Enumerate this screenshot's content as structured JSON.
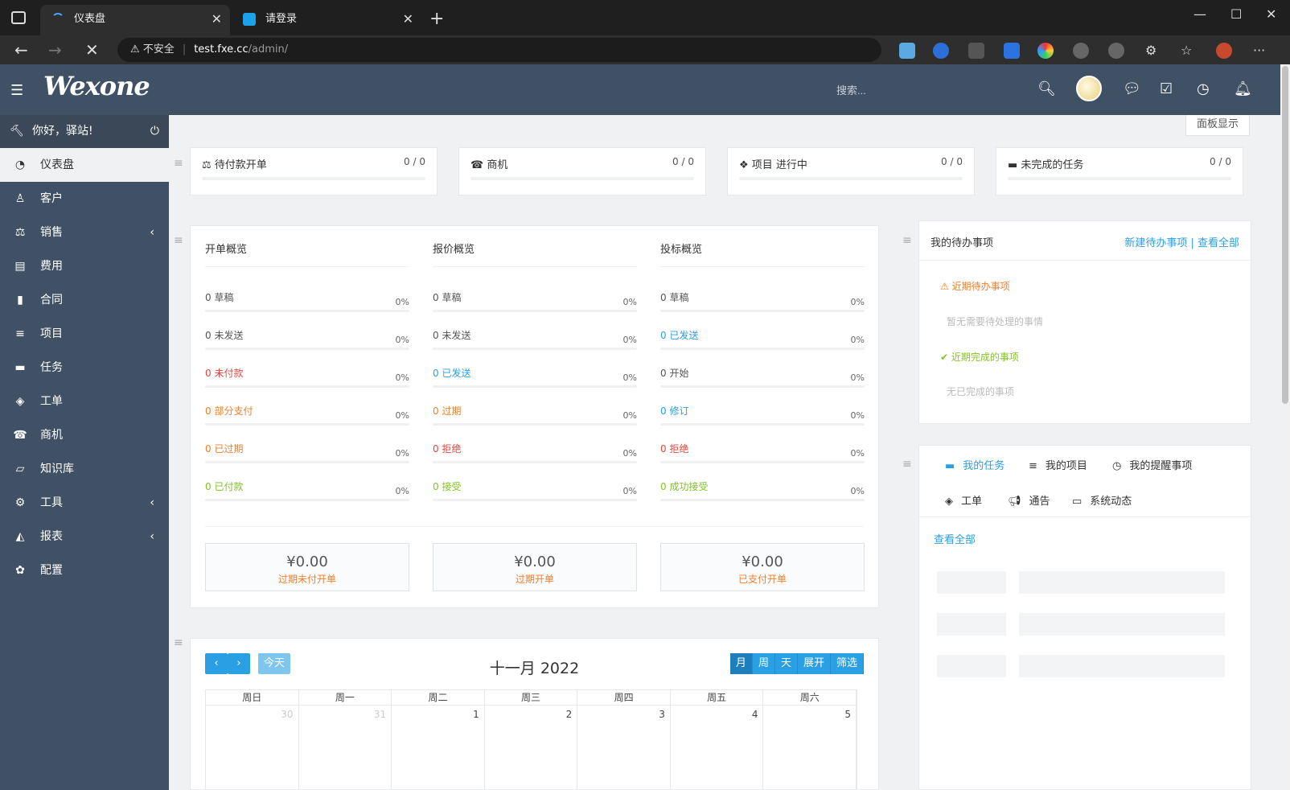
{
  "browser": {
    "tabs": [
      {
        "title": "仪表盘",
        "active": true
      },
      {
        "title": "请登录",
        "active": false
      }
    ],
    "security_label": "不安全",
    "url_domain": "test.fxe.cc",
    "url_path": "/admin/"
  },
  "header": {
    "logo": "Wexone",
    "search_placeholder": "搜索..."
  },
  "sidebar": {
    "greeting": "你好，驿站!",
    "items": [
      {
        "label": "仪表盘",
        "icon": "dashboard-icon",
        "active": true
      },
      {
        "label": "客户",
        "icon": "user-icon"
      },
      {
        "label": "销售",
        "icon": "balance-scale-icon",
        "has_submenu": true
      },
      {
        "label": "费用",
        "icon": "file-icon"
      },
      {
        "label": "合同",
        "icon": "contract-icon"
      },
      {
        "label": "项目",
        "icon": "bars-icon"
      },
      {
        "label": "任务",
        "icon": "tasks-icon"
      },
      {
        "label": "工单",
        "icon": "ticket-icon"
      },
      {
        "label": "商机",
        "icon": "tty-icon"
      },
      {
        "label": "知识库",
        "icon": "folder-open-icon"
      },
      {
        "label": "工具",
        "icon": "cogs-icon",
        "has_submenu": true
      },
      {
        "label": "报表",
        "icon": "area-chart-icon",
        "has_submenu": true
      },
      {
        "label": "配置",
        "icon": "cog-icon"
      }
    ]
  },
  "main": {
    "panel_button": "面板显示",
    "stats": [
      {
        "label": "待付款开单",
        "value": "0 / 0"
      },
      {
        "label": "商机",
        "value": "0 / 0"
      },
      {
        "label": "项目 进行中",
        "value": "0 / 0"
      },
      {
        "label": "未完成的任务",
        "value": "0 / 0"
      }
    ],
    "overview": {
      "columns": [
        {
          "title": "开单概览",
          "rows": [
            {
              "text": "0 草稿",
              "pct": "0%",
              "color": "gray"
            },
            {
              "text": "0 未发送",
              "pct": "0%",
              "color": "gray"
            },
            {
              "text": "0 未付款",
              "pct": "0%",
              "color": "red"
            },
            {
              "text": "0 部分支付",
              "pct": "0%",
              "color": "orange"
            },
            {
              "text": "0 已过期",
              "pct": "0%",
              "color": "orange"
            },
            {
              "text": "0 已付款",
              "pct": "0%",
              "color": "green"
            }
          ],
          "money": {
            "amount": "¥0.00",
            "label": "过期未付开单"
          }
        },
        {
          "title": "报价概览",
          "rows": [
            {
              "text": "0 草稿",
              "pct": "0%",
              "color": "gray"
            },
            {
              "text": "0 未发送",
              "pct": "0%",
              "color": "gray"
            },
            {
              "text": "0 已发送",
              "pct": "0%",
              "color": "blue"
            },
            {
              "text": "0 过期",
              "pct": "0%",
              "color": "orange"
            },
            {
              "text": "0 拒绝",
              "pct": "0%",
              "color": "red"
            },
            {
              "text": "0 接受",
              "pct": "0%",
              "color": "green"
            }
          ],
          "money": {
            "amount": "¥0.00",
            "label": "过期开单"
          }
        },
        {
          "title": "投标概览",
          "rows": [
            {
              "text": "0 草稿",
              "pct": "0%",
              "color": "gray"
            },
            {
              "text": "0 已发送",
              "pct": "0%",
              "color": "blue"
            },
            {
              "text": "0 开始",
              "pct": "0%",
              "color": "gray"
            },
            {
              "text": "0 修订",
              "pct": "0%",
              "color": "blue"
            },
            {
              "text": "0 拒绝",
              "pct": "0%",
              "color": "red"
            },
            {
              "text": "0 成功接受",
              "pct": "0%",
              "color": "green"
            }
          ],
          "money": {
            "amount": "¥0.00",
            "label": "已支付开单"
          }
        }
      ]
    },
    "todos": {
      "title": "我的待办事项",
      "new_link": "新建待办事项",
      "view_all_link": "| 查看全部",
      "upcoming_label": "近期待办事项",
      "upcoming_empty": "暂无需要待处理的事情",
      "done_label": "近期完成的事项",
      "done_empty": "无已完成的事项"
    },
    "tasks": {
      "tabs": [
        "我的任务",
        "我的项目",
        "我的提醒事项",
        "工单",
        "通告",
        "系统动态"
      ],
      "view_all": "查看全部"
    },
    "calendar": {
      "today_label": "今天",
      "title": "十一月 2022",
      "views": [
        "月",
        "周",
        "天",
        "展开",
        "筛选"
      ],
      "weekdays": [
        "周日",
        "周一",
        "周二",
        "周三",
        "周四",
        "周五",
        "周六"
      ],
      "first_week": [
        "30",
        "31",
        "1",
        "2",
        "3",
        "4",
        "5"
      ]
    }
  },
  "colors": {
    "header_bg": "#415165",
    "accent": "#2b9fe3",
    "red": "#e5463c",
    "orange": "#f07f2c",
    "green": "#84c226"
  }
}
